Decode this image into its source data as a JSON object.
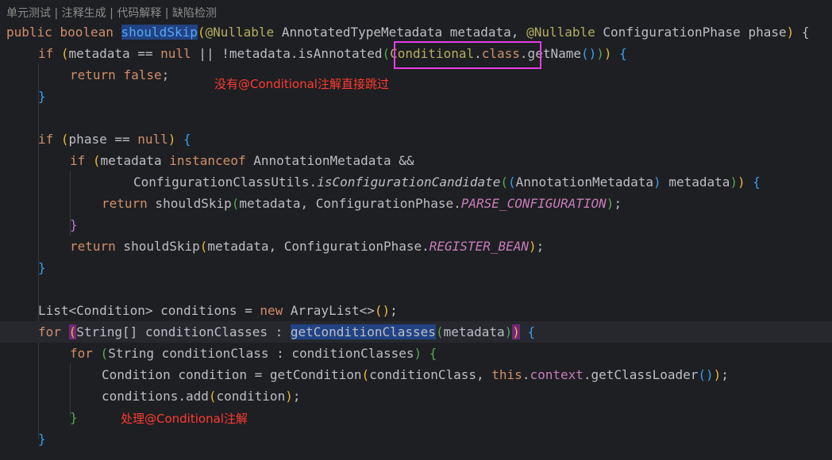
{
  "codelens": {
    "items": [
      "单元测试",
      "注释生成",
      "代码解释",
      "缺陷检测"
    ],
    "separator": " | "
  },
  "editor": {
    "theme_colors": {
      "background": "#1e1f22",
      "keyword": "#cf8e6d",
      "annotation": "#b3ae60",
      "method_decl": "#56a8f5",
      "constant": "#c77dbb",
      "callout": "#e63ee6",
      "note_text": "#ff3b30"
    },
    "lines": {
      "l1": {
        "kw1": "public",
        "kw2": "boolean",
        "fn": "shouldSkip",
        "p_open": "(",
        "ann1": "@Nullable",
        "t1": " AnnotatedTypeMetadata metadata, ",
        "ann2": "@Nullable",
        "t2": " ConfigurationPhase phase",
        "p_close": ")",
        "brace": " {"
      },
      "l2": {
        "kw_if": "if",
        "p1": "(",
        "a": "metadata == ",
        "kw_null": "null",
        "b": " || !metadata.isAnnotated",
        "p2": "(",
        "cls": "Conditional",
        "dot": ".",
        "kw_class": "class",
        "c": ".getName",
        "p3": "()",
        "p2c": ")",
        "p1c": ")",
        "brace": " {"
      },
      "l3": {
        "kw_return": "return",
        "kw_false": "false",
        "semi": ";"
      },
      "l4": {
        "brace": "}"
      },
      "l6": {
        "kw_if": "if",
        "p1": "(",
        "a": "phase == ",
        "kw_null": "null",
        "p1c": ")",
        "brace": " {"
      },
      "l7": {
        "kw_if": "if",
        "p1": "(",
        "a": "metadata ",
        "kw_inst": "instanceof",
        "b": " AnnotationMetadata &&"
      },
      "l8": {
        "a": "ConfigurationClassUtils.",
        "m": "isConfigurationCandidate",
        "p2": "(",
        "p3": "(",
        "b": "AnnotationMetadata",
        "p3c": ")",
        "c": " metadata",
        "p2c": ")",
        "p1c": ")",
        "brace": " {"
      },
      "l9": {
        "kw_return": "return",
        "a": " shouldSkip",
        "p": "(",
        "b": "metadata, ConfigurationPhase.",
        "cst": "PARSE_CONFIGURATION",
        "pc": ")",
        "semi": ";"
      },
      "l10": {
        "brace": "}"
      },
      "l11": {
        "kw_return": "return",
        "a": " shouldSkip",
        "p": "(",
        "b": "metadata, ConfigurationPhase.",
        "cst": "REGISTER_BEAN",
        "pc": ")",
        "semi": ";"
      },
      "l12": {
        "brace": "}"
      },
      "l14": {
        "a": "List<Condition> conditions = ",
        "kw_new": "new",
        "b": " ArrayList<>",
        "p": "()",
        "semi": ";"
      },
      "l15": {
        "kw_for": "for",
        "p1": "(",
        "a": "String[] conditionClasses : ",
        "m": "getConditionClasses",
        "p2": "(",
        "b": "metadata",
        "p2c": ")",
        "p1c": ")",
        "brace": " {"
      },
      "l16": {
        "kw_for": "for",
        "p1": "(",
        "a": "String conditionClass : conditionClasses",
        "p1c": ")",
        "brace": " {"
      },
      "l17": {
        "a": "Condition condition = getCondition",
        "p": "(",
        "b": "conditionClass, ",
        "kw_this": "this",
        "dot": ".",
        "fld": "context",
        "c": ".getClassLoader",
        "p2": "()",
        "pc": ")",
        "semi": ";"
      },
      "l18": {
        "a": "conditions.add",
        "p": "(",
        "b": "condition",
        "pc": ")",
        "semi": ";"
      },
      "l19": {
        "brace": "}"
      },
      "l20": {
        "brace": "}"
      }
    }
  },
  "annotations": {
    "note1": "没有@Conditional注解直接跳过",
    "note2": "处理@Conditional注解"
  }
}
